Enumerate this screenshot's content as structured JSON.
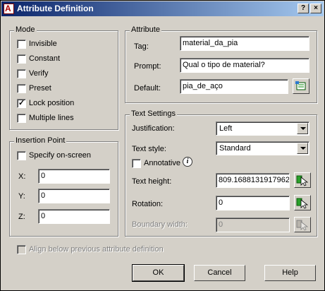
{
  "window": {
    "title": "Attribute Definition",
    "close_glyph": "×",
    "help_glyph": "?"
  },
  "mode": {
    "legend": "Mode",
    "items": [
      {
        "label": "Invisible",
        "checked": false
      },
      {
        "label": "Constant",
        "checked": false
      },
      {
        "label": "Verify",
        "checked": false
      },
      {
        "label": "Preset",
        "checked": false
      },
      {
        "label": "Lock position",
        "checked": true
      },
      {
        "label": "Multiple lines",
        "checked": false
      }
    ]
  },
  "attribute": {
    "legend": "Attribute",
    "tag_label": "Tag:",
    "tag_value": "material_da_pia",
    "prompt_label": "Prompt:",
    "prompt_value": "Qual o tipo de material?",
    "default_label": "Default:",
    "default_value": "pia_de_aço"
  },
  "insertion_point": {
    "legend": "Insertion Point",
    "specify_label": "Specify on-screen",
    "x_label": "X:",
    "x_value": "0",
    "y_label": "Y:",
    "y_value": "0",
    "z_label": "Z:",
    "z_value": "0"
  },
  "text_settings": {
    "legend": "Text Settings",
    "justification_label": "Justification:",
    "justification_value": "Left",
    "text_style_label": "Text style:",
    "text_style_value": "Standard",
    "annotative_label": "Annotative",
    "text_height_label": "Text height:",
    "text_height_value": "809.1688131917962",
    "rotation_label": "Rotation:",
    "rotation_value": "0",
    "boundary_width_label": "Boundary width:",
    "boundary_width_value": "0"
  },
  "align_label": "Align below previous attribute definition",
  "buttons": {
    "ok": "OK",
    "cancel": "Cancel",
    "help": "Help"
  }
}
